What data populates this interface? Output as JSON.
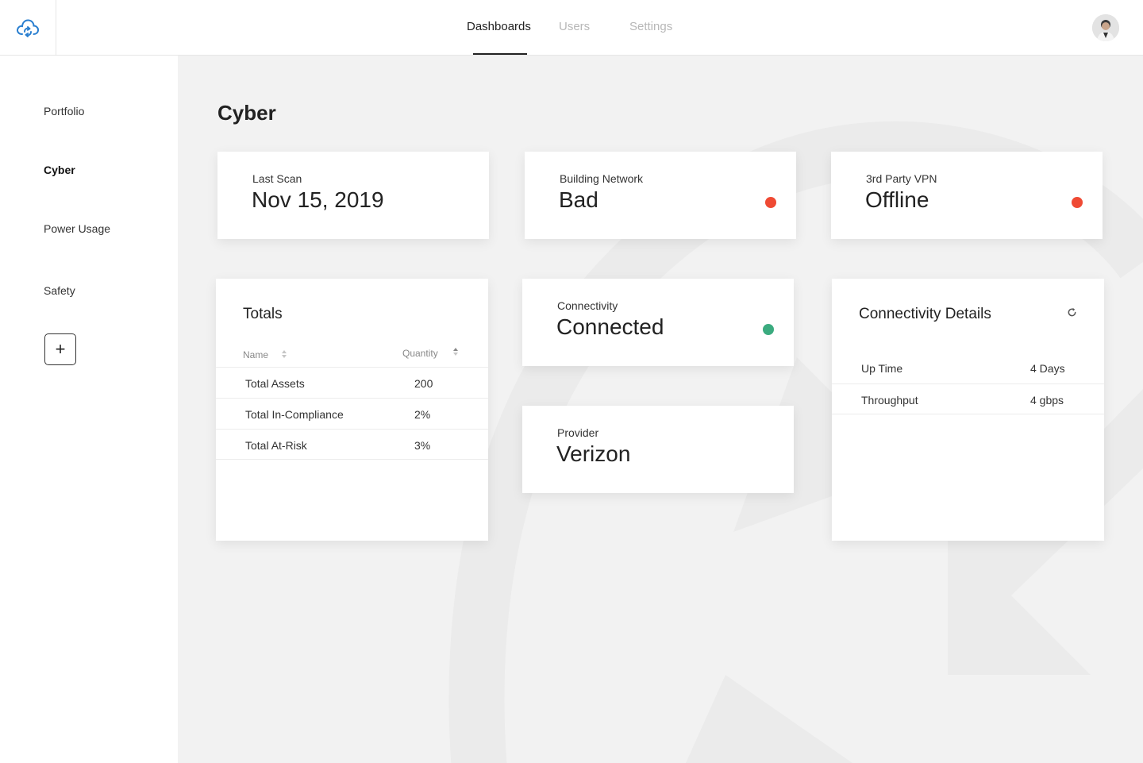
{
  "nav": {
    "tabs": [
      "Dashboards",
      "Users",
      "Settings"
    ],
    "active": "Dashboards"
  },
  "sidebar": {
    "items": [
      {
        "label": "Portfolio"
      },
      {
        "label": "Cyber"
      },
      {
        "label": "Power Usage"
      },
      {
        "label": "Safety"
      }
    ],
    "active": "Cyber",
    "add_label": "+"
  },
  "page": {
    "title": "Cyber"
  },
  "cards": {
    "last_scan": {
      "label": "Last Scan",
      "value": "Nov 15, 2019"
    },
    "building_network": {
      "label": "Building Network",
      "value": "Bad",
      "status_color": "#ef4a34"
    },
    "vpn": {
      "label": "3rd Party VPN",
      "value": "Offline",
      "status_color": "#ef4a34"
    },
    "connectivity": {
      "label": "Connectivity",
      "value": "Connected",
      "status_color": "#3bab7f"
    },
    "provider": {
      "label": "Provider",
      "value": "Verizon"
    }
  },
  "totals": {
    "title": "Totals",
    "columns": [
      "Name",
      "Quantity"
    ],
    "rows": [
      {
        "name": "Total Assets",
        "quantity": "200"
      },
      {
        "name": "Total In-Compliance",
        "quantity": "2%"
      },
      {
        "name": "Total At-Risk",
        "quantity": "3%"
      }
    ]
  },
  "connectivity_details": {
    "title": "Connectivity Details",
    "icon": "refresh-icon",
    "rows": [
      {
        "label": "Up Time",
        "value": "4 Days"
      },
      {
        "label": "Throughput",
        "value": "4 gbps"
      }
    ]
  },
  "colors": {
    "logo": "#2a7fd0",
    "status_bad": "#ef4a34",
    "status_good": "#3bab7f"
  }
}
